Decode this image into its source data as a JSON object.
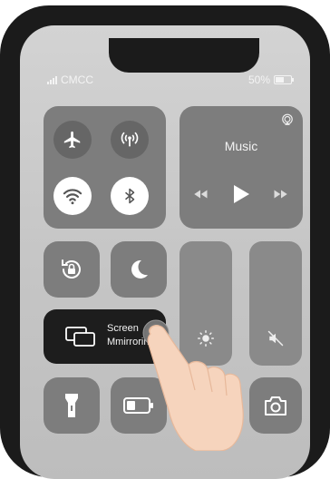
{
  "status": {
    "carrier": "CMCC",
    "battery": "50%",
    "battery_level": 0.5
  },
  "music": {
    "title": "Music",
    "icons": [
      "airplay-icon",
      "previous-icon",
      "play-icon",
      "next-icon"
    ]
  },
  "controls": {
    "airplane": "airplane-icon",
    "cellular": "cellular-icon",
    "wifi": "wifi-icon",
    "bluetooth": "bluetooth-icon",
    "rotation_lock": "rotation-lock-icon",
    "do_not_disturb": "moon-icon",
    "brightness": "brightness-icon",
    "mute": "mute-icon",
    "flashlight": "flashlight-icon",
    "battery_toggle": "battery-icon",
    "camera": "camera-icon"
  },
  "screen_mirroring": {
    "line1": "Screen",
    "line2": "Mmirroring"
  },
  "colors": {
    "tile": "#7d7d7d",
    "tile_active": "#1d1d1d",
    "circle_active": "#ffffff",
    "circle_inactive": "#666666"
  }
}
